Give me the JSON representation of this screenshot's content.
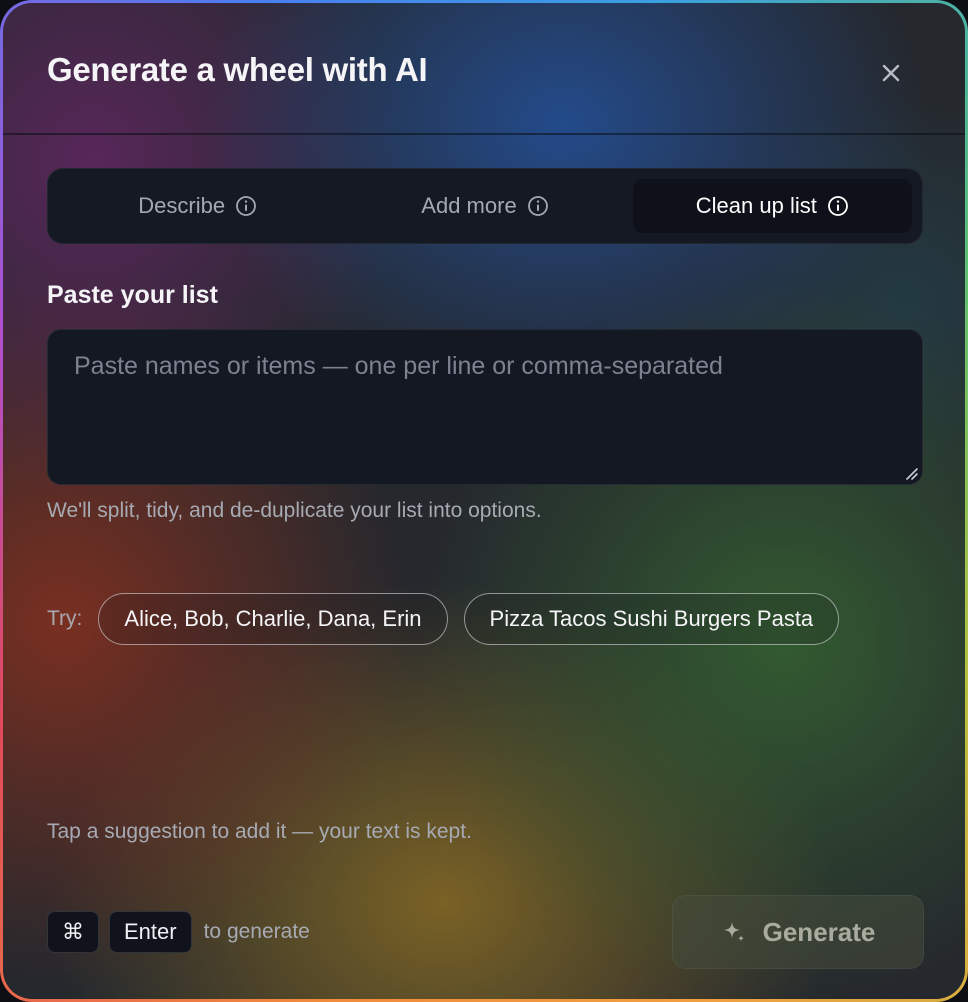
{
  "dialog": {
    "title": "Generate a wheel with AI",
    "close_icon": "close-icon"
  },
  "tabs": [
    {
      "label": "Describe",
      "icon": "info-icon",
      "active": false
    },
    {
      "label": "Add more",
      "icon": "info-icon",
      "active": false
    },
    {
      "label": "Clean up list",
      "icon": "info-icon",
      "active": true
    }
  ],
  "paste": {
    "label": "Paste your list",
    "value": "",
    "placeholder": "Paste names or items — one per line or comma-separated",
    "helper": "We'll split, tidy, and de-duplicate your list into options."
  },
  "suggestions": {
    "try_label": "Try:",
    "chips": [
      "Alice, Bob, Charlie, Dana, Erin",
      "Pizza Tacos Sushi Burgers Pasta"
    ],
    "hint": "Tap a suggestion to add it — your text is kept."
  },
  "footer": {
    "shortcut_keys": [
      "⌘",
      "Enter"
    ],
    "shortcut_text": "to generate",
    "generate_label": "Generate",
    "generate_icon": "sparkle-icon",
    "generate_enabled": false
  }
}
